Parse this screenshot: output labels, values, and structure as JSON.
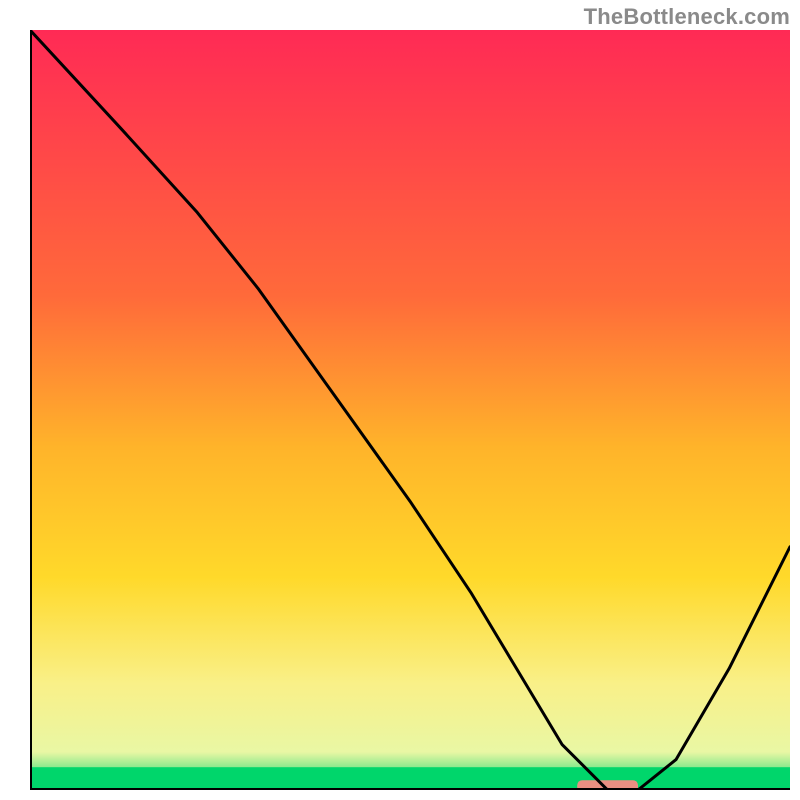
{
  "watermark": "TheBottleneck.com",
  "chart_data": {
    "type": "line",
    "title": "",
    "xlabel": "",
    "ylabel": "",
    "xlim": [
      0,
      100
    ],
    "ylim": [
      0,
      100
    ],
    "grid": false,
    "legend": false,
    "background_gradient": {
      "stops": [
        {
          "offset": 0.0,
          "color": "#ff2a55"
        },
        {
          "offset": 0.35,
          "color": "#ff6a3a"
        },
        {
          "offset": 0.55,
          "color": "#ffb42a"
        },
        {
          "offset": 0.72,
          "color": "#ffd92a"
        },
        {
          "offset": 0.86,
          "color": "#f9f088"
        },
        {
          "offset": 0.95,
          "color": "#e9f7a4"
        },
        {
          "offset": 1.0,
          "color": "#00d66b"
        }
      ]
    },
    "green_band": {
      "y_from": 0,
      "y_to": 3
    },
    "series": [
      {
        "name": "curve",
        "x": [
          0,
          12,
          22,
          30,
          40,
          50,
          58,
          64,
          70,
          76,
          80,
          85,
          92,
          100
        ],
        "y": [
          100,
          87,
          76,
          66,
          52,
          38,
          26,
          16,
          6,
          0,
          0,
          4,
          16,
          32
        ]
      }
    ],
    "marker": {
      "x_from": 72,
      "x_to": 80,
      "y": 0.5,
      "color": "#e98f82"
    },
    "accent_colors": {
      "axis": "#000000",
      "curve": "#000000",
      "marker": "#e98f82"
    }
  }
}
